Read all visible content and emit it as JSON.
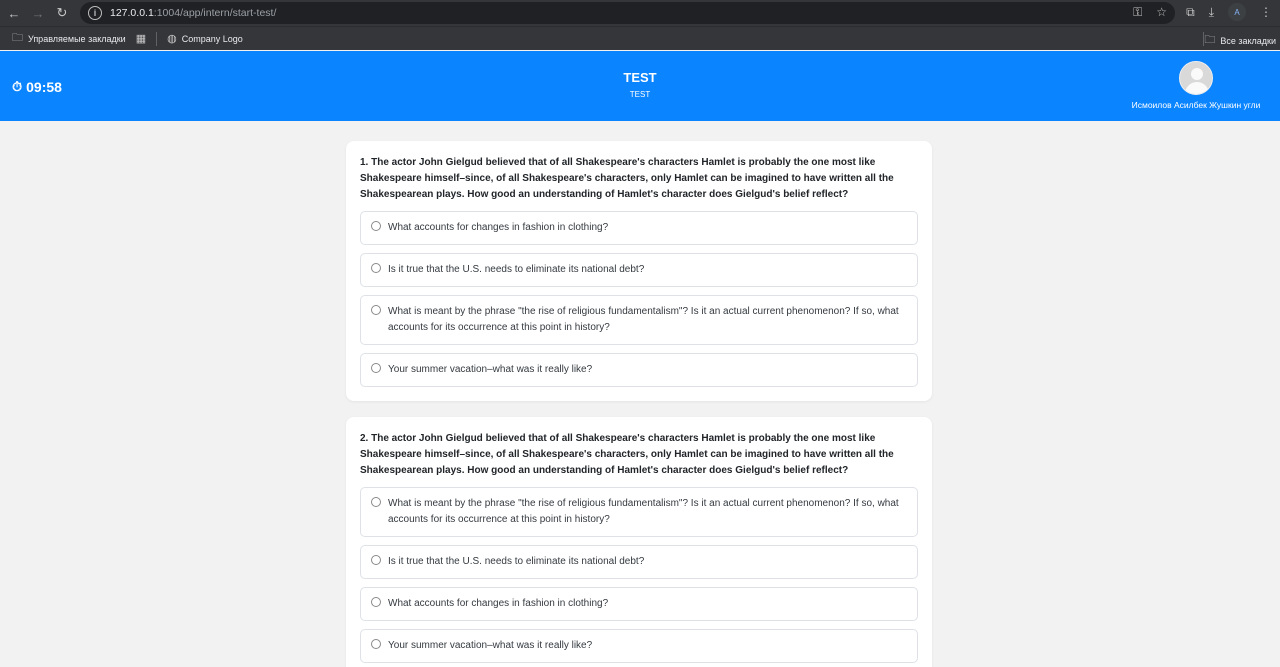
{
  "browser": {
    "url_host": "127.0.0.1",
    "url_path": ":1004/app/intern/start-test/",
    "bookmarks": [
      {
        "label": "Управляемые закладки"
      },
      {
        "label": "Company Logo"
      }
    ],
    "all_bookmarks_label": "Все закладки",
    "profile_initial": "A"
  },
  "header": {
    "timer": "09:58",
    "title": "TEST",
    "subtitle": "TEST",
    "user_name": "Исмоилов Асилбек Жушкин угли"
  },
  "questions": [
    {
      "text": "1. The actor John Gielgud believed that of all Shakespeare's characters Hamlet is probably the one most like Shakespeare himself–since, of all Shakespeare's characters, only Hamlet can be imagined to have written all the Shakespearean plays. How good an understanding of Hamlet's character does Gielgud's belief reflect?",
      "options": [
        "What accounts for changes in fashion in clothing?",
        "Is it true that the U.S. needs to eliminate its national debt?",
        "What is meant by the phrase \"the rise of religious fundamentalism\"? Is it an actual current phenomenon? If so, what accounts for its occurrence at this point in history?",
        "Your summer vacation–what was it really like?"
      ]
    },
    {
      "text": "2. The actor John Gielgud believed that of all Shakespeare's characters Hamlet is probably the one most like Shakespeare himself–since, of all Shakespeare's characters, only Hamlet can be imagined to have written all the Shakespearean plays. How good an understanding of Hamlet's character does Gielgud's belief reflect?",
      "options": [
        "What is meant by the phrase \"the rise of religious fundamentalism\"? Is it an actual current phenomenon? If so, what accounts for its occurrence at this point in history?",
        "Is it true that the U.S. needs to eliminate its national debt?",
        "What accounts for changes in fashion in clothing?",
        "Your summer vacation–what was it really like?"
      ]
    }
  ]
}
